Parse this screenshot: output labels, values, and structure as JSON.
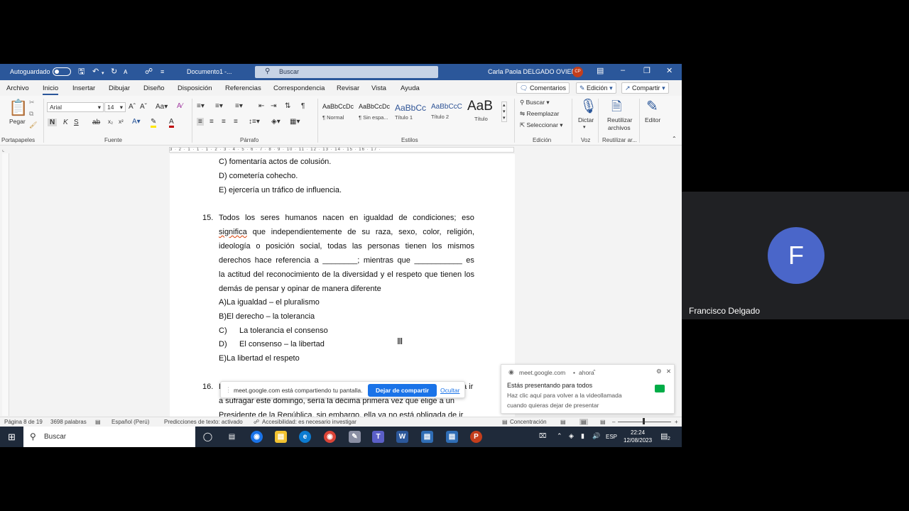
{
  "word": {
    "titlebar": {
      "autosave_label": "Autoguardado",
      "doc_title": "Documento1",
      "doc_title_suffix": "-...",
      "search_placeholder": "Buscar",
      "user_name": "Carla Paola DELGADO OVIEDO",
      "user_initials": "CP"
    },
    "menu_tabs": [
      "Archivo",
      "Inicio",
      "Insertar",
      "Dibujar",
      "Diseño",
      "Disposición",
      "Referencias",
      "Correspondencia",
      "Revisar",
      "Vista",
      "Ayuda"
    ],
    "active_tab": "Inicio",
    "ribbon_buttons": {
      "comments": "Comentarios",
      "editing": "Edición",
      "share": "Compartir"
    },
    "ribbon": {
      "paste_label": "Pegar",
      "font_name": "Arial",
      "font_size": "14",
      "styles": [
        {
          "sample": "AaBbCcDc",
          "name": "¶ Normal"
        },
        {
          "sample": "AaBbCcDc",
          "name": "¶ Sin espa..."
        },
        {
          "sample": "AaBbCc",
          "name": "Título 1"
        },
        {
          "sample": "AaBbCcC",
          "name": "Título 2"
        },
        {
          "sample": "AaB",
          "name": "Título"
        }
      ],
      "find_label": "Buscar",
      "replace_label": "Reemplazar",
      "select_label": "Seleccionar",
      "dictate_label": "Dictar",
      "reuse_label_1": "Reutilizar",
      "reuse_label_2": "archivos",
      "editor_label": "Editor",
      "groups": {
        "clipboard": "Portapapeles",
        "font": "Fuente",
        "paragraph": "Párrafo",
        "styles": "Estilos",
        "editing": "Edición",
        "voice": "Voz",
        "reuse": "Reutilizar ar..."
      }
    },
    "ruler_text": "3 · 2 · 1 · 1 · 1 · 2 · 3 · 4 · 5 · 6 · 7 · 8 · 9 · 10 · 11 · 12 · 13 · 14 · 15 · 16 · 17 ·",
    "document": {
      "prev_options": [
        "C) fomentaría actos de colusión.",
        "D) cometería cohecho.",
        "E) ejercería un tráfico de influencia."
      ],
      "q15_number": "15.",
      "q15_lines": [
        [
          "Todos",
          "los",
          "seres",
          "humanos",
          "nacen",
          "en",
          "igualdad",
          "de",
          "condiciones;",
          "eso"
        ],
        [
          "significa",
          "que",
          "independientemente",
          "de",
          "su",
          "raza,",
          "sexo,",
          "color,",
          "religión,"
        ],
        [
          "ideología",
          "o",
          "posición",
          "social,",
          "todas",
          "las",
          "personas",
          "tienen",
          "los",
          "mismos"
        ],
        [
          "derechos",
          "hace",
          "referencia",
          "a",
          "________;",
          "mientras",
          "que",
          "___________",
          "es"
        ],
        [
          "la",
          "actitud",
          "del",
          "reconocimiento",
          "de",
          "la",
          "diversidad",
          "y",
          "el",
          "respeto",
          "que",
          "tienen",
          "los"
        ]
      ],
      "q15_last_line": "demás de pensar y opinar de manera diferente",
      "q15_options": [
        "A)La igualdad – el pluralismo",
        "B)El derecho – la tolerancia",
        "C)",
        "La tolerancia el consenso",
        "D)",
        "El consenso – la libertad",
        "E)La libertad el respeto"
      ],
      "q16_number": "16.",
      "q16_start": "L",
      "q16_right_frag": "a ir",
      "q16_line2": "a sufragar este domingo, sería la décima primera vez que elige a un",
      "q16_line3": "Presidente de la República, sin embargo, ella ya no está obligada de ir"
    },
    "share_bar": {
      "message": "meet.google.com está compartiendo tu pantalla.",
      "stop_button": "Dejar de compartir",
      "hide_link": "Ocultar"
    },
    "notification": {
      "source": "meet.google.com",
      "time": "ahora",
      "title": "Estás presentando para todos",
      "body_line1": "Haz clic aquí para volver a la videollamada",
      "body_line2": "cuando quieras dejar de presentar"
    },
    "status": {
      "page": "Página 8 de 19",
      "words": "3698 palabras",
      "language": "Español (Perú)",
      "predictions": "Predicciones de texto: activado",
      "accessibility": "Accesibilidad: es necesario investigar",
      "focus": "Concentración"
    },
    "taskbar": {
      "search": "Buscar",
      "lang": "ESP",
      "time": "22:24",
      "date": "12/08/2023",
      "notif_count": "2"
    }
  },
  "meet_tile": {
    "initial": "F",
    "name": "Francisco Delgado",
    "avatar_color": "#4a66c9"
  },
  "colors": {
    "word_blue": "#2b579a",
    "meet_blue": "#1a73e8"
  }
}
